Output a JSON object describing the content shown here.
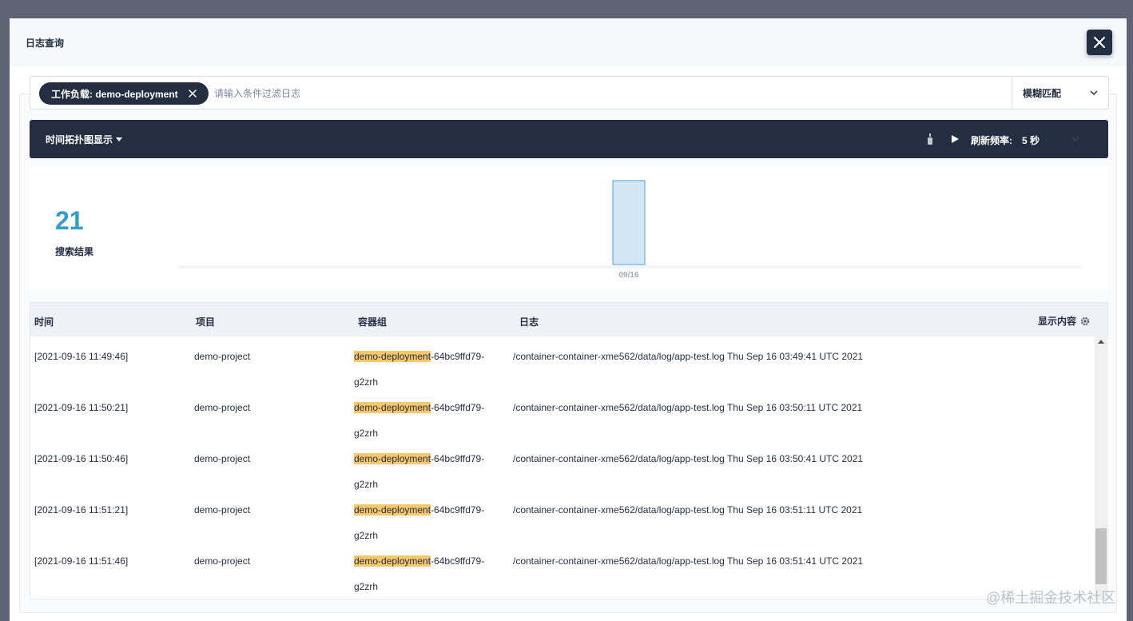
{
  "modal": {
    "title": "日志查询"
  },
  "search": {
    "tag_label": "工作负载: demo-deployment",
    "placeholder": "请输入条件过滤日志",
    "match_mode": "模糊匹配"
  },
  "toolbar": {
    "view_label": "时间拓扑图显示",
    "refresh_label": "刷新频率:",
    "refresh_value": "5 秒"
  },
  "stats": {
    "count": "21",
    "count_label": "搜索结果"
  },
  "chart_data": {
    "type": "bar",
    "categories": [
      "09/16"
    ],
    "values": [
      21
    ],
    "title": "",
    "xlabel": "",
    "ylabel": "",
    "ylim": [
      0,
      21
    ],
    "colors": {
      "fill": "#d1e8f4",
      "stroke": "#4a9fcf"
    }
  },
  "table": {
    "headers": {
      "time": "时间",
      "project": "项目",
      "pod": "容器组",
      "log": "日志",
      "display": "显示内容"
    },
    "rows": [
      {
        "time": "[2021-09-16 11:49:46]",
        "project": "demo-project",
        "pod_highlight": "demo-deployment",
        "pod_rest": "-64bc9ffd79-g2zrh",
        "log": "/container-container-xme562/data/log/app-test.log Thu Sep 16 03:49:41 UTC 2021"
      },
      {
        "time": "[2021-09-16 11:50:21]",
        "project": "demo-project",
        "pod_highlight": "demo-deployment",
        "pod_rest": "-64bc9ffd79-g2zrh",
        "log": "/container-container-xme562/data/log/app-test.log Thu Sep 16 03:50:11 UTC 2021"
      },
      {
        "time": "[2021-09-16 11:50:46]",
        "project": "demo-project",
        "pod_highlight": "demo-deployment",
        "pod_rest": "-64bc9ffd79-g2zrh",
        "log": "/container-container-xme562/data/log/app-test.log Thu Sep 16 03:50:41 UTC 2021"
      },
      {
        "time": "[2021-09-16 11:51:21]",
        "project": "demo-project",
        "pod_highlight": "demo-deployment",
        "pod_rest": "-64bc9ffd79-g2zrh",
        "log": "/container-container-xme562/data/log/app-test.log Thu Sep 16 03:51:11 UTC 2021"
      },
      {
        "time": "[2021-09-16 11:51:46]",
        "project": "demo-project",
        "pod_highlight": "demo-deployment",
        "pod_rest": "-64bc9ffd79-g2zrh",
        "log": "/container-container-xme562/data/log/app-test.log Thu Sep 16 03:51:41 UTC 2021"
      }
    ]
  },
  "watermark": "@稀土掘金技术社区",
  "icons": {
    "close": "close-icon",
    "tag_close": "close-icon",
    "select": "chevron-down-icon",
    "download": "download-icon",
    "play": "play-icon",
    "settings": "gear-icon"
  },
  "colors": {
    "dark": "#242e42",
    "accent": "#329dce",
    "highlight": "#f7c76b"
  }
}
